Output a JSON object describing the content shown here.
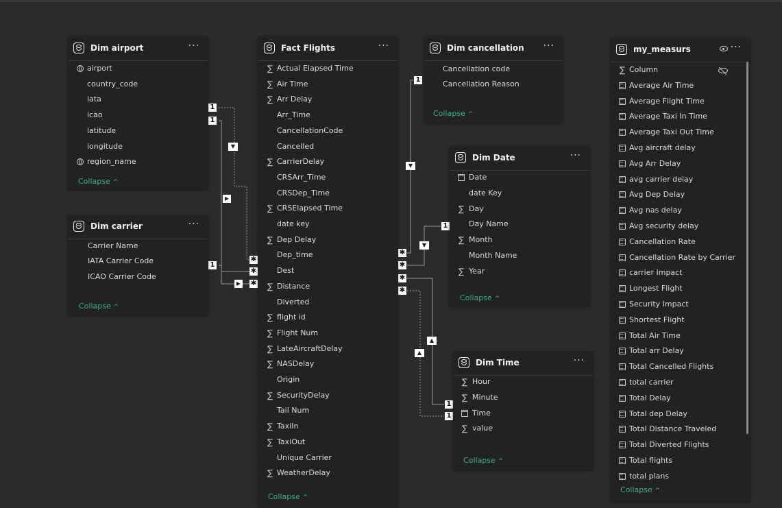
{
  "tables": {
    "dim_airport": {
      "title": "Dim airport",
      "more": "···",
      "fields": [
        "airport",
        "country_code",
        "iata",
        "icao",
        "latitude",
        "longitude",
        "region_name"
      ],
      "icons": [
        "globe",
        "",
        "",
        "",
        "",
        "",
        "globe"
      ],
      "collapse": "Collapse"
    },
    "dim_carrier": {
      "title": "Dim carrier",
      "more": "···",
      "fields": [
        "Carrier Name",
        "IATA Carrier Code",
        "ICAO Carrier Code"
      ],
      "collapse": "Collapse"
    },
    "fact_flights": {
      "title": "Fact Flights",
      "more": "···",
      "fields": [
        "Actual Elapsed Time",
        "Air Time",
        "Arr Delay",
        "Arr_Time",
        "CancellationCode",
        "Cancelled",
        "CarrierDelay",
        "CRSArr_Time",
        "CRSDep_Time",
        "CRSElapsed Time",
        "date key",
        "Dep Delay",
        "Dep_time",
        "Dest",
        "Distance",
        "Diverted",
        "flight id",
        "Flight Num",
        "LateAircraftDelay",
        "NASDelay",
        "Origin",
        "SecurityDelay",
        "Tail Num",
        "TaxiIn",
        "TaxiOut",
        "Unique Carrier",
        "WeatherDelay"
      ],
      "icons": [
        "sigma",
        "sigma",
        "sigma",
        "",
        "",
        "",
        "sigma",
        "",
        "",
        "sigma",
        "",
        "sigma",
        "",
        "",
        "sigma",
        "",
        "sigma",
        "sigma",
        "sigma",
        "sigma",
        "",
        "sigma",
        "",
        "sigma",
        "sigma",
        "",
        "sigma"
      ],
      "collapse": "Collapse"
    },
    "dim_cancellation": {
      "title": "Dim cancellation",
      "more": "···",
      "fields": [
        "Cancellation code",
        "Cancellation Reason"
      ],
      "collapse": "Collapse"
    },
    "dim_date": {
      "title": "Dim Date",
      "more": "···",
      "fields": [
        "Date",
        "date Key",
        "Day",
        "Day Name",
        "Month",
        "Month Name",
        "Year"
      ],
      "icons": [
        "cal",
        "",
        "sigma",
        "",
        "sigma",
        "",
        "sigma"
      ],
      "collapse": "Collapse"
    },
    "dim_time": {
      "title": "Dim Time",
      "more": "···",
      "fields": [
        "Hour",
        "Minute",
        "Time",
        "value"
      ],
      "icons": [
        "sigma",
        "sigma",
        "cal",
        "sigma"
      ],
      "collapse": "Collapse"
    },
    "my_measurs": {
      "title": "my_measurs",
      "more": "···",
      "fields": [
        "Column",
        "Average Air Time",
        "Average Flight Time",
        "Average Taxi In Time",
        "Average Taxi Out Time",
        "Avg aircraft delay",
        "Avg Arr Delay",
        "avg carrier delay",
        "Avg Dep Delay",
        "Avg nas delay",
        "Avg security delay",
        "Cancellation Rate",
        "Cancellation Rate by Carrier",
        "carrier Impact",
        "Longest Flight",
        "Security Impact",
        "Shortest Flight",
        "Total Air Time",
        "Total arr Delay",
        "Total Cancelled Flights",
        "total carrier",
        "Total Delay",
        "Total dep Delay",
        "Total Distance Traveled",
        "Total Diverted Flights",
        "Total flights",
        "total plans"
      ],
      "icons": [
        "sigma",
        "calc",
        "calc",
        "calc",
        "calc",
        "calc",
        "calc",
        "calc",
        "calc",
        "calc",
        "calc",
        "calc",
        "calc",
        "calc",
        "calc",
        "calc",
        "calc",
        "calc",
        "calc",
        "calc",
        "calc",
        "calc",
        "calc",
        "calc",
        "calc",
        "calc",
        "calc"
      ],
      "collapse": "Collapse"
    }
  },
  "relationship_labels": {
    "one": "1",
    "many": "✱"
  }
}
